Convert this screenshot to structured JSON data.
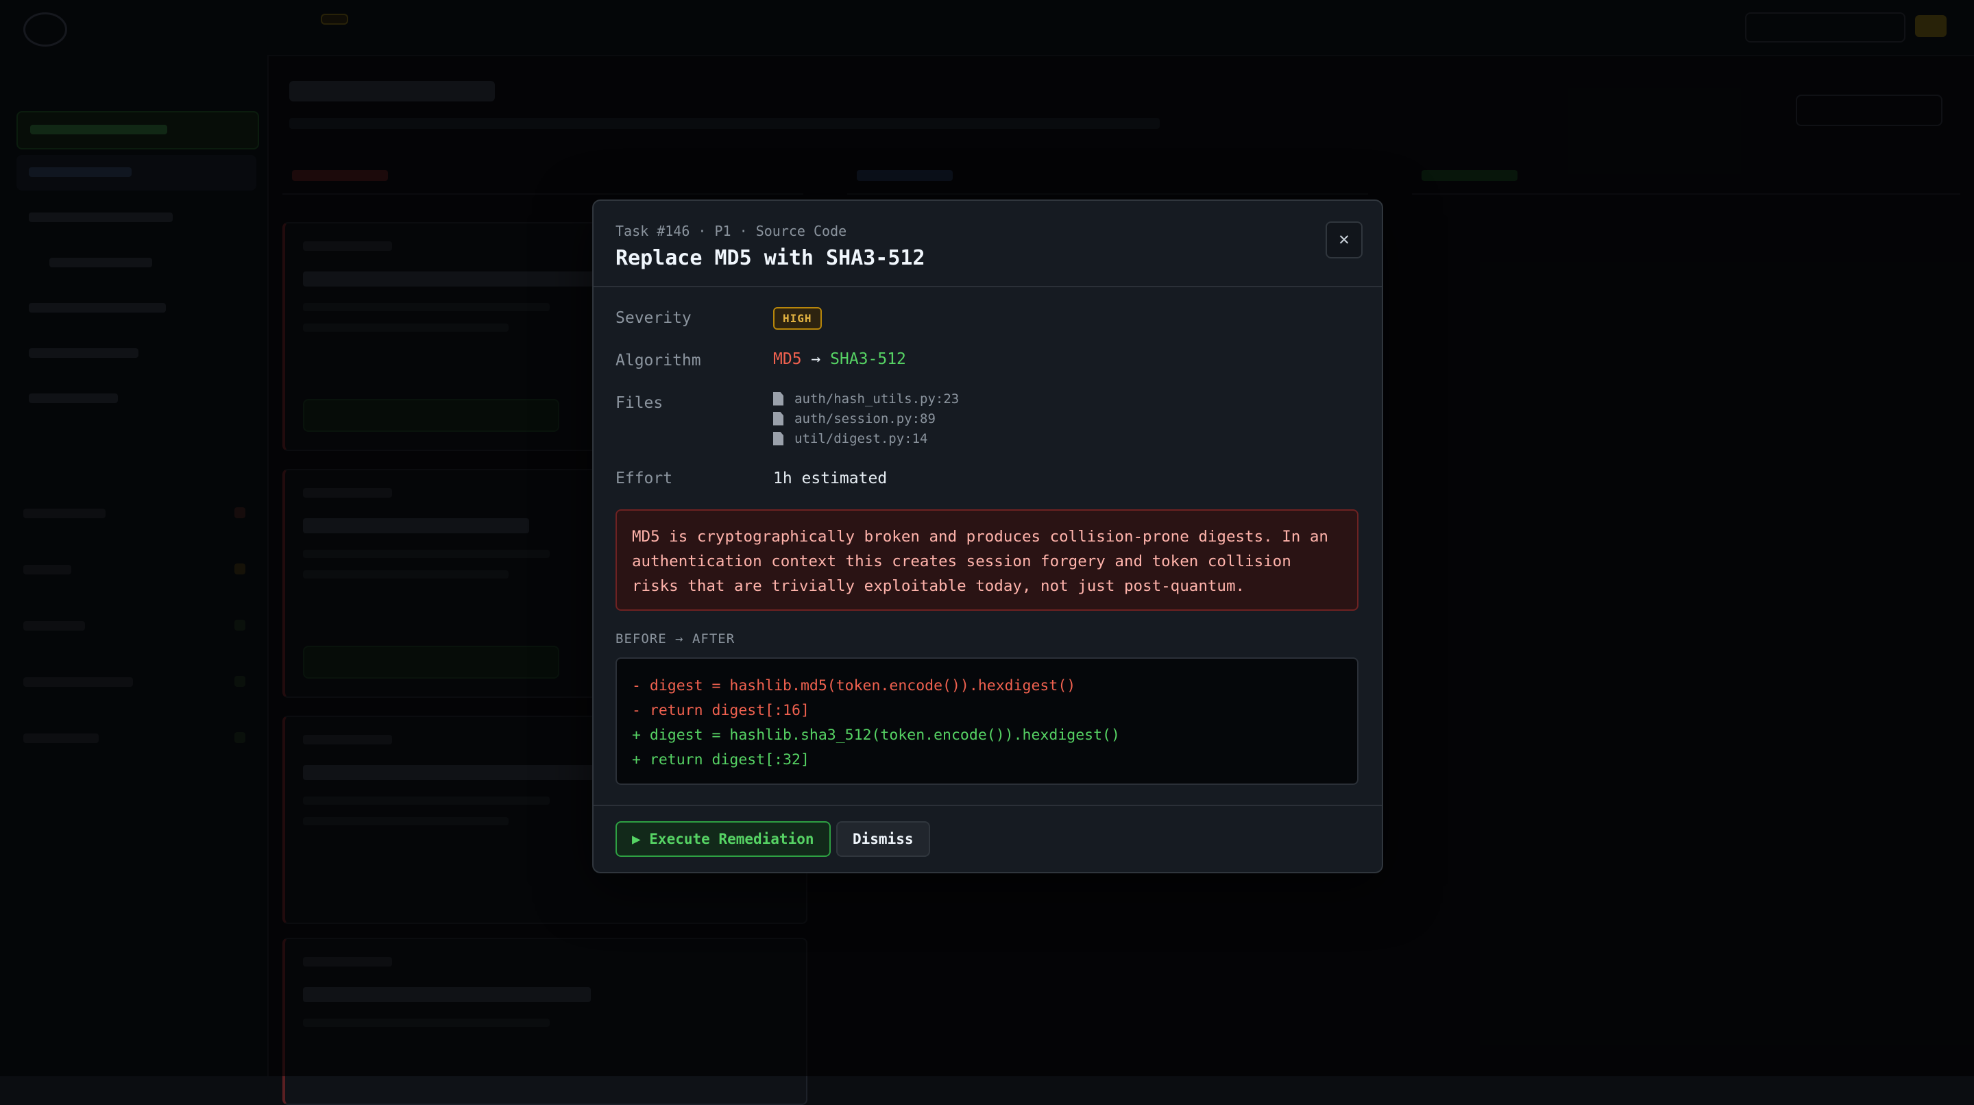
{
  "modal": {
    "meta": "Task #146 · P1 · Source Code",
    "title": "Replace MD5 with SHA3-512",
    "close_label": "✕",
    "severity": {
      "label": "Severity",
      "value": "HIGH",
      "color": "#e3b341"
    },
    "algorithm": {
      "label": "Algorithm",
      "from": "MD5",
      "arrow": "→",
      "to": "SHA3-512"
    },
    "files": {
      "label": "Files",
      "items": [
        "auth/hash_utils.py:23",
        "auth/session.py:89",
        "util/digest.py:14"
      ]
    },
    "effort": {
      "label": "Effort",
      "value": "1h estimated"
    },
    "warning": "MD5 is cryptographically broken and produces collision-prone digests. In an authentication context this creates session forgery and token collision risks that are trivially exploitable today, not just post-quantum.",
    "diff": {
      "label": "BEFORE → AFTER",
      "lines": [
        {
          "type": "del",
          "text": "- digest = hashlib.md5(token.encode()).hexdigest()"
        },
        {
          "type": "del",
          "text": "- return digest[:16]"
        },
        {
          "type": "add",
          "text": "+ digest = hashlib.sha3_512(token.encode()).hexdigest()"
        },
        {
          "type": "add",
          "text": "+ return digest[:32]"
        }
      ]
    },
    "actions": {
      "execute": "▶ Execute Remediation",
      "dismiss": "Dismiss"
    }
  },
  "colors": {
    "accent_green": "#56d364",
    "danger_red": "#f0614f",
    "warning_yellow": "#e3b341"
  }
}
